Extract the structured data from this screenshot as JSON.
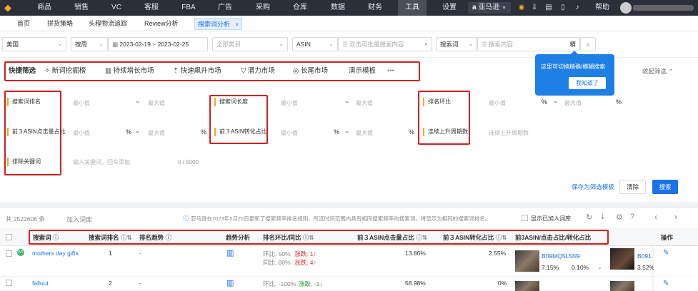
{
  "nav": {
    "items": [
      "商品",
      "销售",
      "VC",
      "客服",
      "FBA",
      "广告",
      "采购",
      "仓库",
      "数据",
      "财务",
      "工具",
      "设置"
    ],
    "active": "工具",
    "store": "亚马逊",
    "help": "帮助"
  },
  "tabs": [
    "首页",
    "拼货策略",
    "头程物流追踪",
    "Review分析",
    "搜索词分析"
  ],
  "active_tab": "搜索词分析",
  "filters": {
    "country": "美国",
    "period": "按周",
    "date_range": "2023-02-19 ~ 2023-02-25",
    "category_placeholder": "全部类目",
    "asin_type": "ASIN",
    "asin_placeholder": "双击可批量搜索内容",
    "keyword_type": "搜索词",
    "keyword_placeholder": "搜索内容",
    "precise": "精"
  },
  "quick_filter": {
    "title": "快捷筛选",
    "items": [
      "新词挖掘榜",
      "持续增长市场",
      "快速飙升市场",
      "潜力市场",
      "长尾市场",
      "演示模板"
    ],
    "more": "•••",
    "collapse": "收起筛选"
  },
  "tooltip": {
    "text": "这里可切换精确/模糊搜索",
    "button": "我知道了"
  },
  "conditions": {
    "search_rank": "搜索词排名",
    "keyword_length": "搜索词长度",
    "rank_change": "排名环比",
    "top3_click": "前３ASIN点击量占比",
    "top3_conv": "前３ASIN转化占比",
    "consecutive": "连续上升周期数",
    "consecutive_ph": "连续上升周期数",
    "exclude": "排除关键词",
    "exclude_ph": "输入关键词，回车添加",
    "exclude_count": "0 / 5000",
    "min": "最小值",
    "max": "最大值",
    "tilde": "~",
    "pct": "%"
  },
  "actions": {
    "save_template": "保存为筛选模板",
    "reset": "清除",
    "search": "搜索"
  },
  "toolbar": {
    "total": "共 2522606 条",
    "add_lib": "加入词库",
    "notice": "亚马逊在2023年5月22日更新了搜索频率排名规则，所选时间范围内具有相同搜索频率的搜索词，将显示为相同的搜索词排名。",
    "show_added": "显示已加入词库"
  },
  "table": {
    "headers": [
      "搜索词",
      "搜索词排名",
      "排名趋势",
      "趋势分析",
      "排名环比/同比",
      "前３ASIN点击量占比",
      "前３ASIN转化占比",
      "前3ASIN/点击占比/转化占比",
      "操作"
    ],
    "rows": [
      {
        "keyword": "mothers day gifts",
        "rank": "1",
        "trend": "-",
        "mom_label": "环比: 50%",
        "mom_rise": "涨跌: 1",
        "yoy_label": "同比: 80%",
        "yoy_rise": "涨跌: 4",
        "click_share": "13.86%",
        "conv_share": "2.55%",
        "asin": "B09MQ5L5N9",
        "asin_click": "7.15%",
        "asin_conv": "0.10%",
        "asin2": "B091",
        "asin2_click": "3.52%"
      },
      {
        "keyword": "fallout",
        "rank": "2",
        "trend": "-",
        "mom_label": "环比: -100%",
        "mom_rise": "涨跌: -1",
        "click_share": "58.98%",
        "conv_share": "0%"
      }
    ]
  },
  "colors": {
    "nav_bg": "#2b2f3a",
    "accent": "#1a73e8",
    "highlight_box": "#d32020",
    "label_marker": "#f5a623"
  }
}
